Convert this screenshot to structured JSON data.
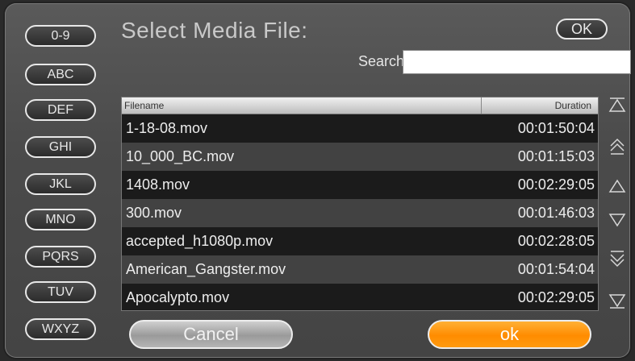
{
  "dialog": {
    "title": "Select Media File:",
    "ok_top_label": "OK"
  },
  "search": {
    "label": "Search:",
    "value": "",
    "placeholder": ""
  },
  "letters": [
    "0-9",
    "ABC",
    "DEF",
    "GHI",
    "JKL",
    "MNO",
    "PQRS",
    "TUV",
    "WXYZ"
  ],
  "table": {
    "columns": {
      "filename": "Filename",
      "duration": "Duration"
    },
    "rows": [
      {
        "filename": "1-18-08.mov",
        "duration": "00:01:50:04"
      },
      {
        "filename": "10_000_BC.mov",
        "duration": "00:01:15:03"
      },
      {
        "filename": "1408.mov",
        "duration": "00:02:29:05"
      },
      {
        "filename": "300.mov",
        "duration": "00:01:46:03"
      },
      {
        "filename": "accepted_h1080p.mov",
        "duration": "00:02:28:05"
      },
      {
        "filename": "American_Gangster.mov",
        "duration": "00:01:54:04"
      },
      {
        "filename": "Apocalypto.mov",
        "duration": "00:02:29:05"
      }
    ]
  },
  "nav_icons": [
    "scroll-top-icon",
    "page-up-icon",
    "line-up-icon",
    "line-down-icon",
    "page-down-icon",
    "scroll-bottom-icon"
  ],
  "buttons": {
    "cancel_label": "Cancel",
    "ok_label": "ok"
  },
  "colors": {
    "accent": "#ff8c00",
    "background": "#4b4b4b",
    "row_dark": "#1b1b1b",
    "row_light": "#424242"
  }
}
